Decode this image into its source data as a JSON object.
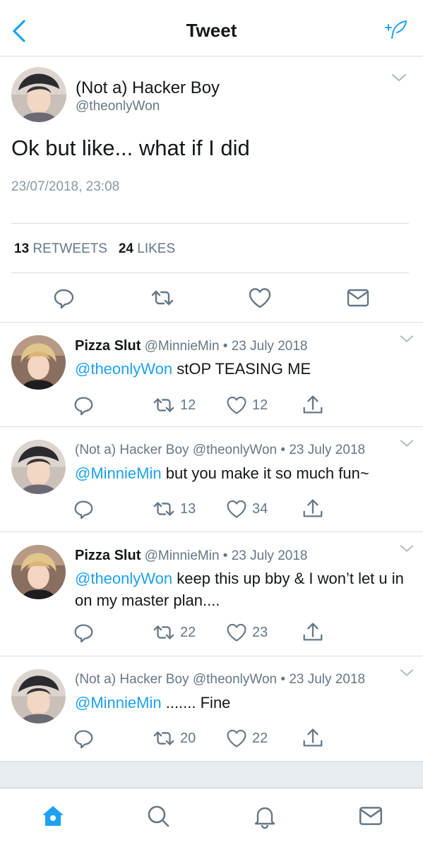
{
  "header": {
    "title": "Tweet",
    "back_icon": "back-chevron-icon",
    "compose_icon": "compose-feather-icon",
    "accent_color": "#1da1f2"
  },
  "main_tweet": {
    "display_name": "(Not a) Hacker Boy",
    "handle": "@theonlyWon",
    "text": "Ok but like... what if I did",
    "timestamp": "23/07/2018, 23:08",
    "retweets_count": "13",
    "retweets_label": "RETWEETS",
    "likes_count": "24",
    "likes_label": "LIKES"
  },
  "replies": [
    {
      "name": "Pizza Slut",
      "handle": "@MinnieMin",
      "date": "23 July 2018",
      "mention": "@theonlyWon",
      "text": "stOP TEASING ME",
      "retweets": "12",
      "likes": "12"
    },
    {
      "name": "(Not a) Hacker Boy",
      "handle": "@theonlyWon",
      "date": "23 July 2018",
      "mention": "@MinnieMin",
      "text": "but you make it so much fun~",
      "retweets": "13",
      "likes": "34"
    },
    {
      "name": "Pizza Slut",
      "handle": "@MinnieMin",
      "date": "23 July 2018",
      "mention": "@theonlyWon",
      "text": "keep this up bby & I won’t let u in on my master plan....",
      "retweets": "22",
      "likes": "23"
    },
    {
      "name": "(Not a) Hacker Boy",
      "handle": "@theonlyWon",
      "date": "23 July 2018",
      "mention": "@MinnieMin",
      "text": "....... Fine",
      "retweets": "20",
      "likes": "22"
    }
  ],
  "separator": "•",
  "tabbar": {
    "items": [
      "home-icon",
      "search-icon",
      "notifications-bell-icon",
      "messages-envelope-icon"
    ],
    "active": "home-icon"
  }
}
